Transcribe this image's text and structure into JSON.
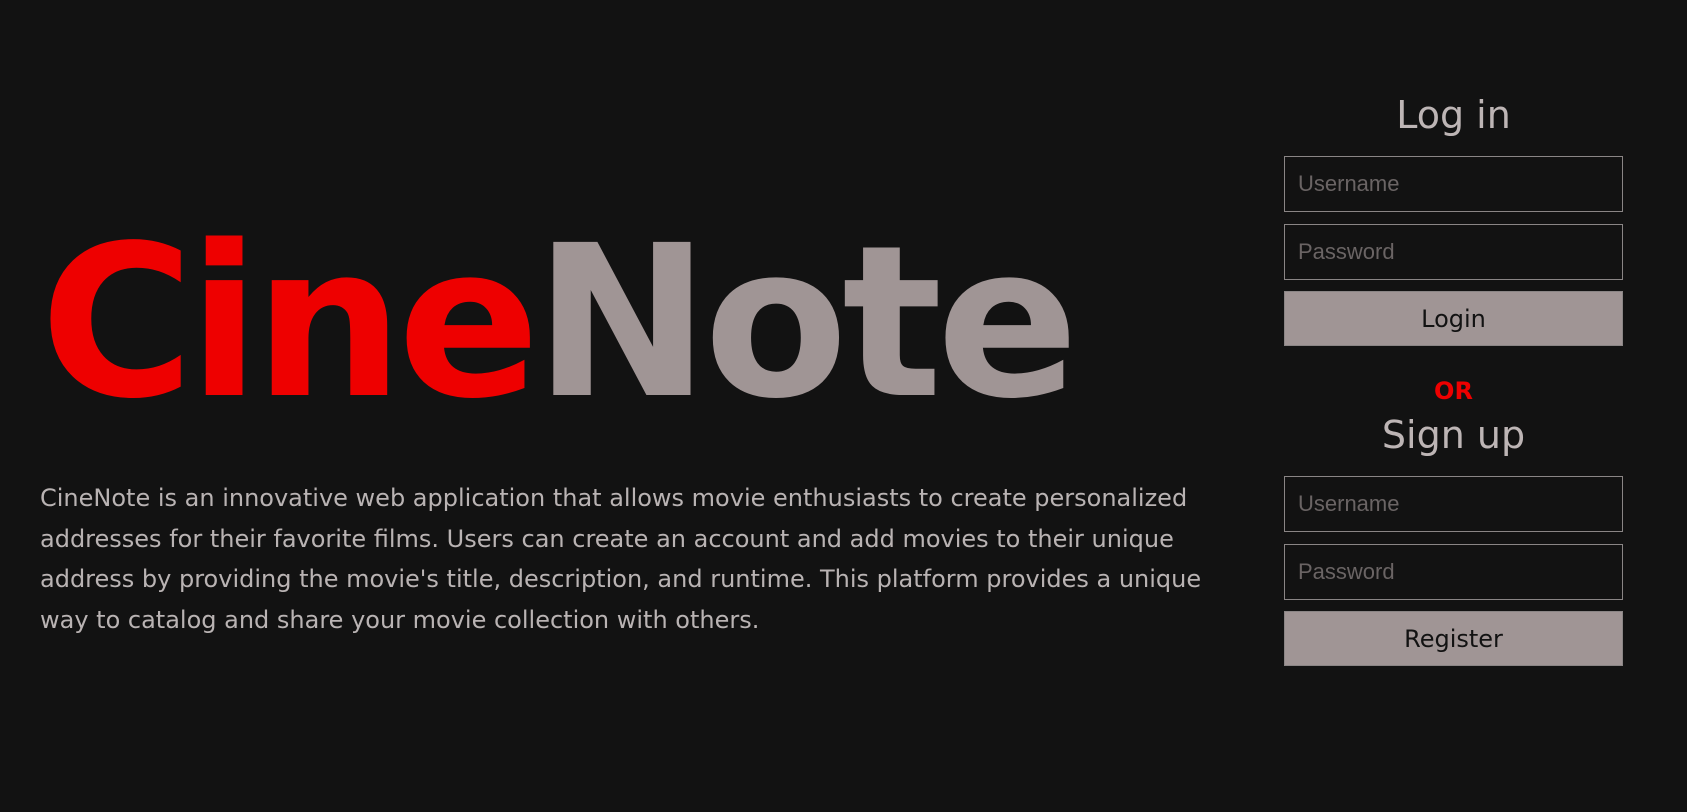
{
  "logo": {
    "part1": "Cine",
    "part2": "Note",
    "colors": {
      "part1": "#ee0000",
      "part2": "#a09595"
    }
  },
  "description": "CineNote is an innovative web application that allows movie enthusiasts to create personalized addresses for their favorite films. Users can create an account and add movies to their unique address by providing the movie's title, description, and runtime. This platform provides a unique way to catalog and share your movie collection with others.",
  "login": {
    "title": "Log in",
    "username": {
      "value": "",
      "placeholder": "Username"
    },
    "password": {
      "value": "",
      "placeholder": "Password"
    },
    "button_label": "Login"
  },
  "or_label": "OR",
  "signup": {
    "title": "Sign up",
    "username": {
      "value": "",
      "placeholder": "Username"
    },
    "password": {
      "value": "",
      "placeholder": "Password"
    },
    "button_label": "Register"
  },
  "colors": {
    "background": "#121212",
    "accent": "#ee0000",
    "button": "#a09595",
    "text": "#b9b3b3"
  }
}
